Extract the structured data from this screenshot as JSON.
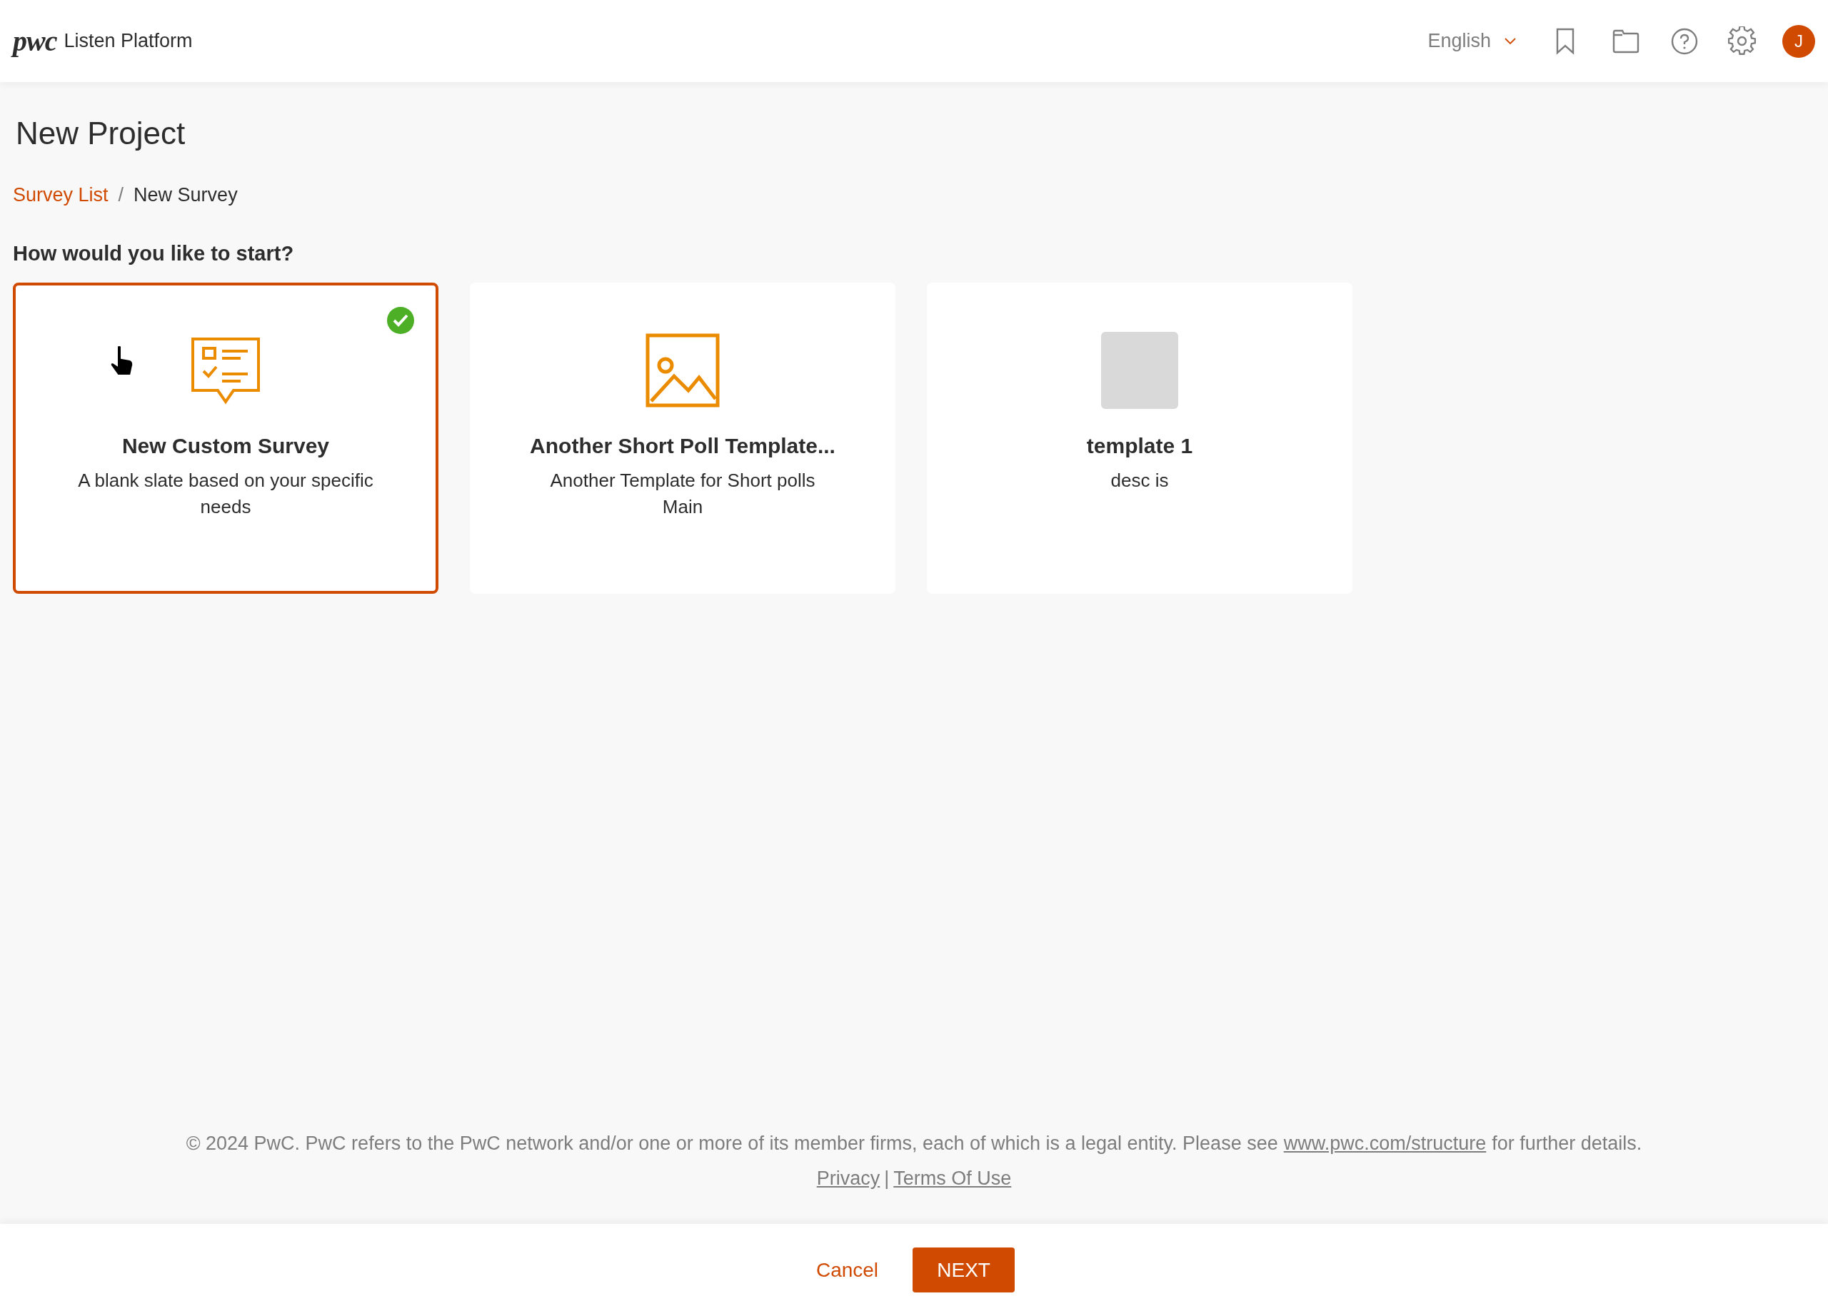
{
  "header": {
    "logo": "pwc",
    "app_name": "Listen Platform",
    "language": "English",
    "avatar_initial": "J"
  },
  "page_title": "New Project",
  "breadcrumb": [
    {
      "label": "Survey List",
      "kind": "link"
    },
    {
      "label": "/",
      "kind": "separator"
    },
    {
      "label": "New Survey",
      "kind": "current"
    }
  ],
  "question": "How would you like to start?",
  "options": [
    {
      "kind": "survey",
      "title": "New Custom Survey",
      "description": "A blank slate based on your specific needs",
      "selected": true,
      "pointer": true
    },
    {
      "kind": "image",
      "title": "Another Short Poll Template...",
      "description": "Another Template for Short polls Main",
      "selected": false,
      "pointer": false
    },
    {
      "kind": "placeholder",
      "title": "template 1",
      "description": "desc is",
      "selected": false,
      "pointer": false
    }
  ],
  "footer": {
    "copyright": "© 2024 PwC. PwC refers to the PwC network and/or one or more of its member firms, each of which is a legal entity. Please see",
    "structure_link": "www.pwc.com/structure",
    "copyright_end": "for further details.",
    "links": [
      {
        "label": "Privacy"
      },
      {
        "label": "Terms Of Use"
      }
    ],
    "link_separator": "|"
  },
  "actions": {
    "cancel": "Cancel",
    "next": "NEXT"
  }
}
